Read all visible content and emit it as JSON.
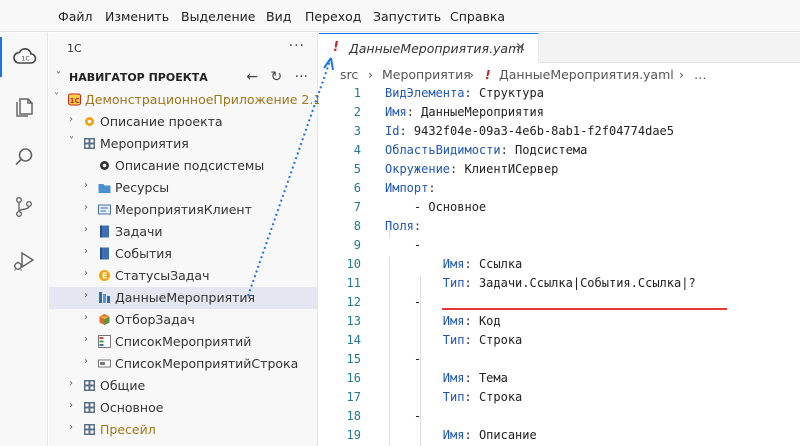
{
  "menu": [
    "Файл",
    "Изменить",
    "Выделение",
    "Вид",
    "Переход",
    "Запустить",
    "Справка"
  ],
  "activity_bar": [
    "cloud-icon",
    "files-icon",
    "search-icon",
    "source-control-icon",
    "run-debug-icon"
  ],
  "sidebar": {
    "title": "1С",
    "more": "···",
    "section_title": "НАВИГАТОР ПРОЕКТА",
    "tools": [
      "←",
      "↻",
      "···"
    ],
    "tree": [
      {
        "label": "ДемонстрационноеПриложение 2.1",
        "icon": "app-1c-icon",
        "chevron": "˅",
        "gold": true
      },
      {
        "label": "Описание проекта",
        "icon": "gear-orange-icon",
        "chevron": "›"
      },
      {
        "label": "Мероприятия",
        "icon": "subsystem-icon",
        "chevron": "˅"
      },
      {
        "label": "Описание подсистемы",
        "icon": "gear-dark-icon",
        "chevron": ""
      },
      {
        "label": "Ресурсы",
        "icon": "folder-icon",
        "chevron": "›"
      },
      {
        "label": "МероприятияКлиент",
        "icon": "module-icon",
        "chevron": "›"
      },
      {
        "label": "Задачи",
        "icon": "catalog-icon",
        "chevron": "›"
      },
      {
        "label": "События",
        "icon": "catalog-icon",
        "chevron": "›"
      },
      {
        "label": "СтатусыЗадач",
        "icon": "enum-icon",
        "chevron": "›"
      },
      {
        "label": "ДанныеМероприятия",
        "icon": "structure-icon",
        "chevron": "›",
        "selected": true
      },
      {
        "label": "ОтборЗадач",
        "icon": "cube-icon",
        "chevron": "›"
      },
      {
        "label": "СписокМероприятий",
        "icon": "list-icon",
        "chevron": "›"
      },
      {
        "label": "СписокМероприятийСтрока",
        "icon": "list-row-icon",
        "chevron": "›"
      },
      {
        "label": "Общие",
        "icon": "subsystem-icon",
        "chevron": "›"
      },
      {
        "label": "Основное",
        "icon": "subsystem-icon",
        "chevron": "›"
      },
      {
        "label": "Пресейл",
        "icon": "subsystem-icon",
        "chevron": "›",
        "gold": true
      }
    ]
  },
  "editor": {
    "tab": {
      "warn": "!",
      "name": "ДанныеМероприятия.yaml",
      "close": "×"
    },
    "breadcrumb": [
      "src",
      "›",
      "Мероприятия",
      "›",
      "!",
      "ДанныеМероприятия.yaml",
      "›",
      "…"
    ],
    "lines": [
      {
        "n": "1",
        "k": "ВидЭлемента",
        "v": "Структура"
      },
      {
        "n": "2",
        "k": "Имя",
        "v": "ДанныеМероприятия"
      },
      {
        "n": "3",
        "k": "Id",
        "v": "9432f04e-09a3-4e6b-8ab1-f2f04774dae5"
      },
      {
        "n": "4",
        "k": "ОбластьВидимости",
        "v": "Подсистема"
      },
      {
        "n": "5",
        "k": "Окружение",
        "v": "КлиентИСервер"
      },
      {
        "n": "6",
        "k": "Импорт",
        "v": ""
      },
      {
        "n": "7",
        "k": "",
        "v": "- Основное"
      },
      {
        "n": "8",
        "k": "Поля",
        "v": ""
      },
      {
        "n": "9",
        "k": "",
        "v": "-"
      },
      {
        "n": "10",
        "k": "Имя",
        "v": "Ссылка"
      },
      {
        "n": "11",
        "k": "Тип",
        "v": "Задачи.Ссылка|События.Ссылка|?"
      },
      {
        "n": "12",
        "k": "",
        "v": "-"
      },
      {
        "n": "13",
        "k": "Имя",
        "v": "Код"
      },
      {
        "n": "14",
        "k": "Тип",
        "v": "Строка"
      },
      {
        "n": "15",
        "k": "",
        "v": "-"
      },
      {
        "n": "16",
        "k": "Имя",
        "v": "Тема"
      },
      {
        "n": "17",
        "k": "Тип",
        "v": "Строка"
      },
      {
        "n": "18",
        "k": "",
        "v": "-"
      },
      {
        "n": "19",
        "k": "Имя",
        "v": "Описание"
      }
    ]
  },
  "colors": {
    "accent": "#1a73e8",
    "key": "#1e56b8",
    "warn": "#c62828",
    "underline": "#e53935",
    "selection": "#e4e6f1"
  }
}
